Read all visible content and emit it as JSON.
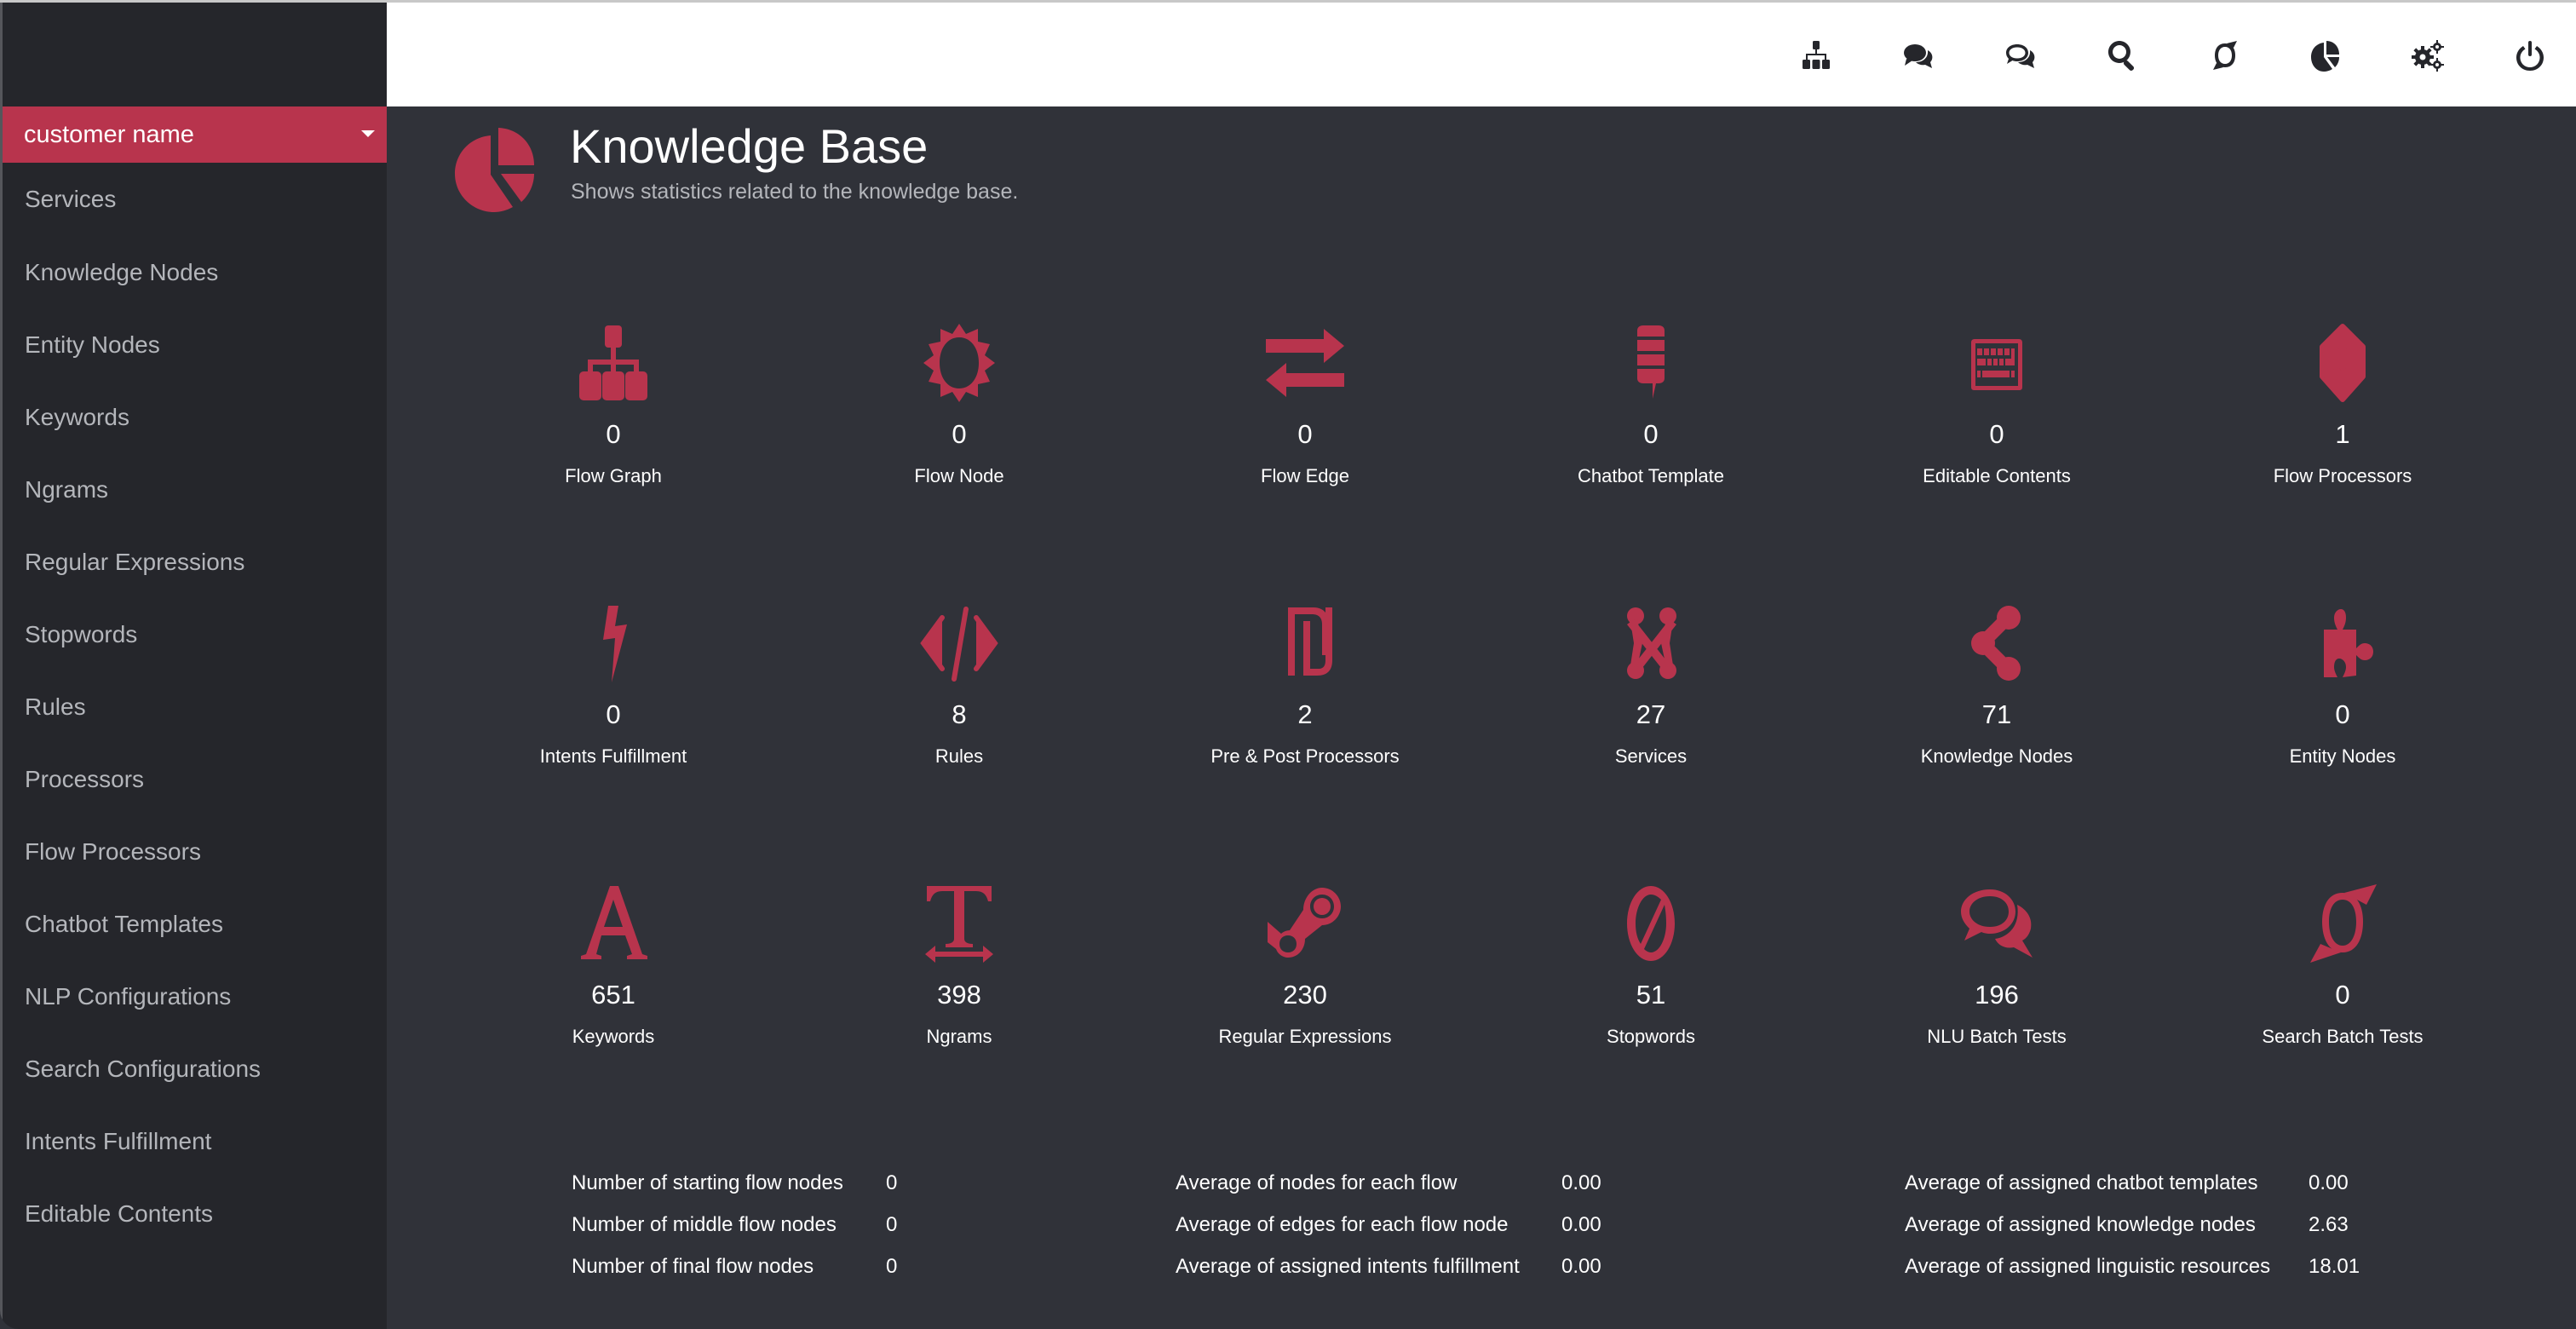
{
  "colors": {
    "accent": "#b8344d",
    "sidebar_bg": "#25262b",
    "main_bg": "#303239",
    "header_bg": "#ffffff"
  },
  "sidebar": {
    "customer_selector": {
      "label": "customer name",
      "icon": "caret-down-icon"
    },
    "items": [
      {
        "label": "Services"
      },
      {
        "label": "Knowledge Nodes"
      },
      {
        "label": "Entity Nodes"
      },
      {
        "label": "Keywords"
      },
      {
        "label": "Ngrams"
      },
      {
        "label": "Regular Expressions"
      },
      {
        "label": "Stopwords"
      },
      {
        "label": "Rules"
      },
      {
        "label": "Processors"
      },
      {
        "label": "Flow Processors"
      },
      {
        "label": "Chatbot Templates"
      },
      {
        "label": "NLP Configurations"
      },
      {
        "label": "Search Configurations"
      },
      {
        "label": "Intents Fulfillment"
      },
      {
        "label": "Editable Contents"
      }
    ]
  },
  "header": {
    "icons": [
      "sitemap-icon",
      "chat-bubbles-icon",
      "chat-bubbles-outline-icon",
      "search-icon",
      "search-batch-icon",
      "pie-chart-icon",
      "settings-gears-icon",
      "power-icon"
    ]
  },
  "page": {
    "icon": "pie-chart-icon",
    "title": "Knowledge Base",
    "subtitle": "Shows statistics related to the knowledge base."
  },
  "stats": [
    {
      "icon": "sitemap-icon",
      "value": "0",
      "label": "Flow Graph"
    },
    {
      "icon": "sun-icon",
      "value": "0",
      "label": "Flow Node"
    },
    {
      "icon": "exchange-arrows-icon",
      "value": "0",
      "label": "Flow Edge"
    },
    {
      "icon": "stacked-speech-bubble-icon",
      "value": "0",
      "label": "Chatbot Template"
    },
    {
      "icon": "keyboard-icon",
      "value": "0",
      "label": "Editable Contents"
    },
    {
      "icon": "codepen-cube-icon",
      "value": "1",
      "label": "Flow Processors"
    },
    {
      "icon": "lightning-bolt-icon",
      "value": "0",
      "label": "Intents Fulfillment"
    },
    {
      "icon": "code-icon",
      "value": "8",
      "label": "Rules"
    },
    {
      "icon": "shekel-icon",
      "value": "2",
      "label": "Pre & Post Processors"
    },
    {
      "icon": "joomla-icon",
      "value": "27",
      "label": "Services"
    },
    {
      "icon": "share-nodes-icon",
      "value": "71",
      "label": "Knowledge Nodes"
    },
    {
      "icon": "puzzle-piece-icon",
      "value": "0",
      "label": "Entity Nodes"
    },
    {
      "icon": "font-letter-a-icon",
      "value": "651",
      "label": "Keywords"
    },
    {
      "icon": "text-width-icon",
      "value": "398",
      "label": "Ngrams"
    },
    {
      "icon": "steam-icon",
      "value": "230",
      "label": "Regular Expressions"
    },
    {
      "icon": "ban-icon",
      "value": "51",
      "label": "Stopwords"
    },
    {
      "icon": "chat-bubbles-outline-icon",
      "value": "196",
      "label": "NLU Batch Tests"
    },
    {
      "icon": "search-batch-icon",
      "value": "0",
      "label": "Search Batch Tests"
    }
  ],
  "summary": [
    [
      {
        "label": "Number of starting flow nodes",
        "value": "0"
      },
      {
        "label": "Number of middle flow nodes",
        "value": "0"
      },
      {
        "label": "Number of final flow nodes",
        "value": "0"
      }
    ],
    [
      {
        "label": "Average of nodes for each flow",
        "value": "0.00"
      },
      {
        "label": "Average of edges for each flow node",
        "value": "0.00"
      },
      {
        "label": "Average of assigned intents fulfillment",
        "value": "0.00"
      }
    ],
    [
      {
        "label": "Average of assigned chatbot templates",
        "value": "0.00"
      },
      {
        "label": "Average of assigned knowledge nodes",
        "value": "2.63"
      },
      {
        "label": "Average of assigned linguistic resources",
        "value": "18.01"
      }
    ]
  ]
}
